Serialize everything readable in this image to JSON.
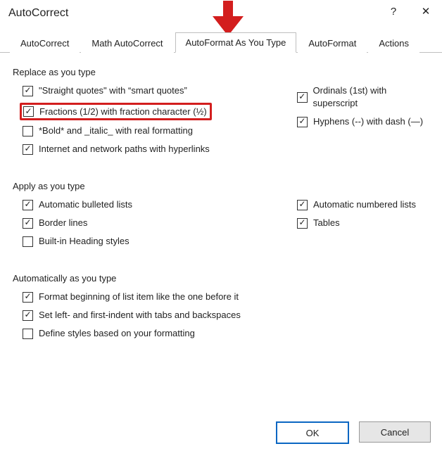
{
  "title": "AutoCorrect",
  "help_glyph": "?",
  "close_glyph": "✕",
  "tabs": [
    {
      "label": "AutoCorrect"
    },
    {
      "label": "Math AutoCorrect"
    },
    {
      "label": "AutoFormat As You Type"
    },
    {
      "label": "AutoFormat"
    },
    {
      "label": "Actions"
    }
  ],
  "sections": {
    "replace": {
      "heading": "Replace as you type",
      "left": [
        {
          "label": "\"Straight quotes\" with “smart quotes”",
          "checked": true,
          "highlight": false
        },
        {
          "label": "Fractions (1/2) with fraction character (½)",
          "checked": true,
          "highlight": true
        },
        {
          "label": "*Bold* and _italic_ with real formatting",
          "checked": false,
          "highlight": false
        },
        {
          "label": "Internet and network paths with hyperlinks",
          "checked": true,
          "highlight": false
        }
      ],
      "right": [
        {
          "label": "Ordinals (1st) with superscript",
          "checked": true
        },
        {
          "label": "Hyphens (--) with dash (—)",
          "checked": true
        }
      ]
    },
    "apply": {
      "heading": "Apply as you type",
      "left": [
        {
          "label": "Automatic bulleted lists",
          "checked": true
        },
        {
          "label": "Border lines",
          "checked": true
        },
        {
          "label": "Built-in Heading styles",
          "checked": false
        }
      ],
      "right": [
        {
          "label": "Automatic numbered lists",
          "checked": true
        },
        {
          "label": "Tables",
          "checked": true
        }
      ]
    },
    "auto": {
      "heading": "Automatically as you type",
      "left": [
        {
          "label": "Format beginning of list item like the one before it",
          "checked": true
        },
        {
          "label": "Set left- and first-indent with tabs and backspaces",
          "checked": true
        },
        {
          "label": "Define styles based on your formatting",
          "checked": false
        }
      ]
    }
  },
  "buttons": {
    "ok": "OK",
    "cancel": "Cancel"
  }
}
